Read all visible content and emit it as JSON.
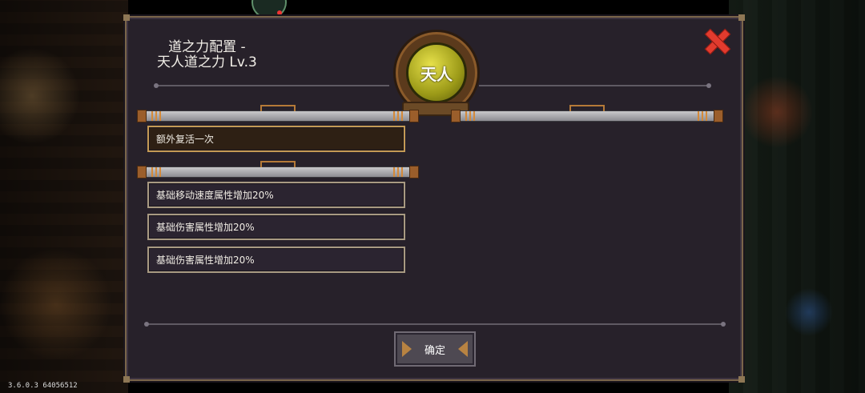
{
  "header": {
    "title_line1": "道之力配置 -",
    "title_line2": "天人道之力 Lv.3",
    "emblem_char": "天人"
  },
  "options_group1": [
    {
      "label": "额外复活一次",
      "selected": true
    }
  ],
  "options_group2": [
    {
      "label": "基础移动速度属性增加20%"
    },
    {
      "label": "基础伤害属性增加20%"
    },
    {
      "label": "基础伤害属性增加20%"
    }
  ],
  "footer": {
    "confirm_label": "确定"
  },
  "version": "3.6.0.3 64056512",
  "colors": {
    "panel": "#27212a",
    "border": "#a89a82",
    "selected_border": "#c49a55",
    "close": "#e23b2e",
    "emblem": "#c8c42a"
  }
}
